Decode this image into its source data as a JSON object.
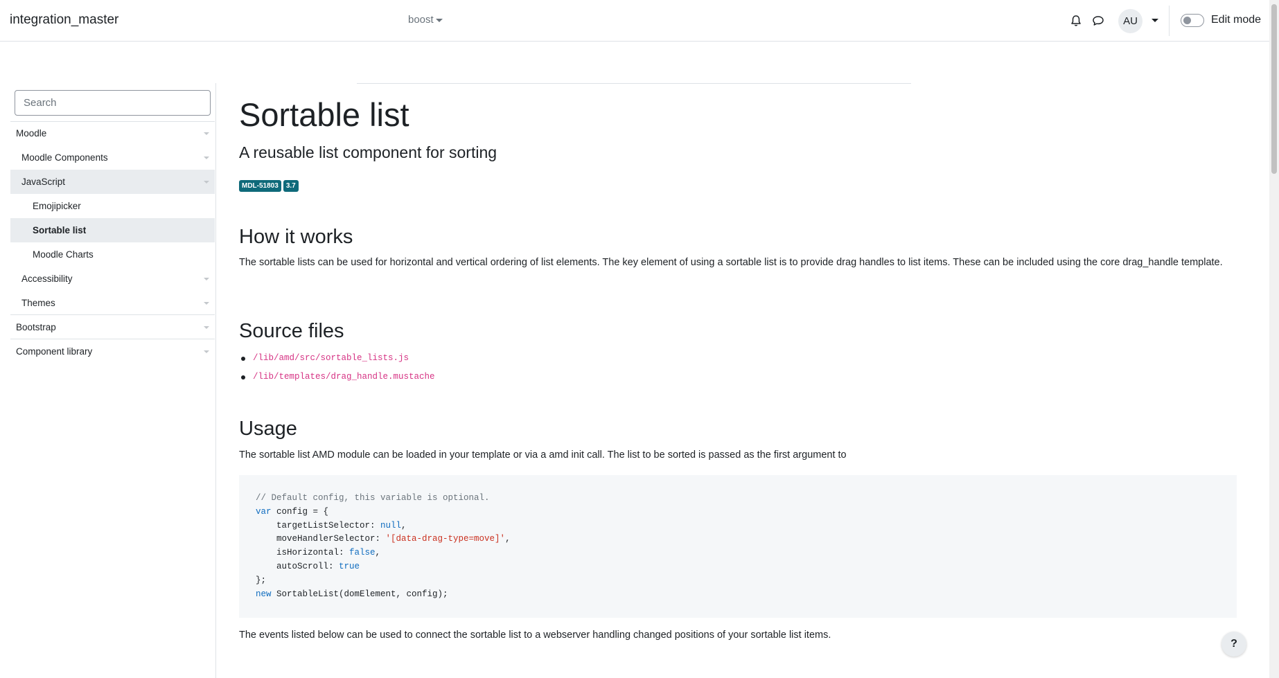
{
  "header": {
    "brand": "integration_master",
    "theme_menu": "boost",
    "avatar_initials": "AU",
    "edit_mode_label": "Edit mode"
  },
  "sidebar": {
    "search_placeholder": "Search",
    "items": [
      {
        "label": "Moodle",
        "expandable": true
      },
      {
        "label": "Moodle Components",
        "expandable": true
      },
      {
        "label": "JavaScript",
        "expandable": true,
        "active": true
      },
      {
        "label": "Emojipicker"
      },
      {
        "label": "Sortable list",
        "selected": true
      },
      {
        "label": "Moodle Charts"
      },
      {
        "label": "Accessibility",
        "expandable": true
      },
      {
        "label": "Themes",
        "expandable": true
      },
      {
        "label": "Bootstrap",
        "expandable": true
      },
      {
        "label": "Component library",
        "expandable": true
      }
    ]
  },
  "main": {
    "title": "Sortable list",
    "subtitle": "A reusable list component for sorting",
    "badges": [
      "MDL-51803",
      "3.7"
    ],
    "how_it_works": {
      "heading": "How it works",
      "text": "The sortable lists can be used for horizontal and vertical ordering of list elements. The key element of using a sortable list is to provide drag handles to list items. These can be included using the core drag_handle template."
    },
    "source_files": {
      "heading": "Source files",
      "files": [
        "/lib/amd/src/sortable_lists.js",
        "/lib/templates/drag_handle.mustache"
      ]
    },
    "usage": {
      "heading": "Usage",
      "text": "The sortable list AMD module can be loaded in your template or via a amd init call. The list to be sorted is passed as the first argument to",
      "code": {
        "comment": "// Default config, this variable is optional.",
        "line_var": "var",
        "line_config_open": " config = {",
        "target_key": "    targetListSelector: ",
        "target_val": "null",
        "move_key": "    moveHandlerSelector: ",
        "move_val": "'[data-drag-type=move]'",
        "horiz_key": "    isHorizontal: ",
        "horiz_val": "false",
        "auto_key": "    autoScroll: ",
        "auto_val": "true",
        "close": "};",
        "new_kw": "new",
        "new_rest": " SortableList(domElement, config);"
      },
      "events_text": "The events listed below can be used to connect the sortable list to a webserver handling changed positions of your sortable list items."
    },
    "help_label": "?"
  }
}
